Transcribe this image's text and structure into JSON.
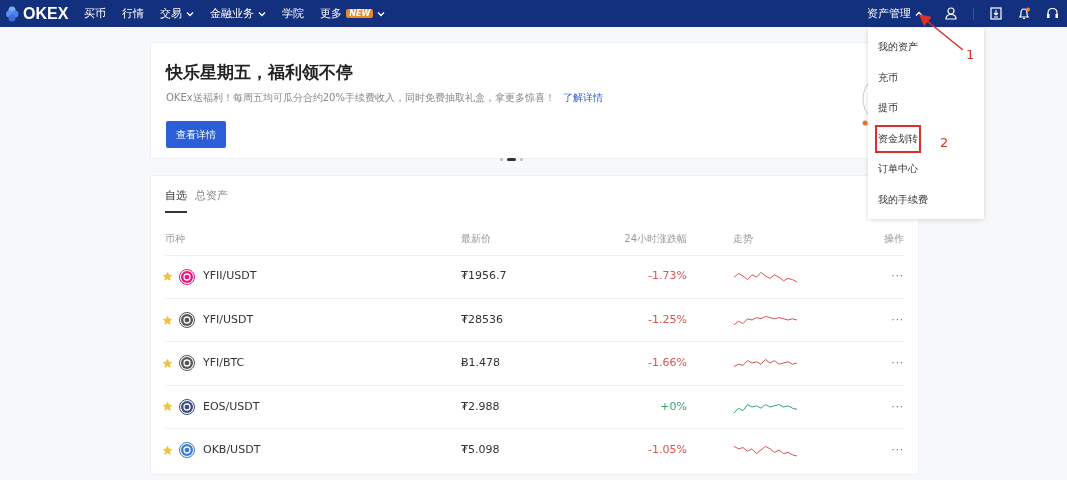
{
  "navbar": {
    "logo": "OKEX",
    "items": [
      {
        "label": "买币",
        "caret": false
      },
      {
        "label": "行情",
        "caret": false
      },
      {
        "label": "交易",
        "caret": true
      },
      {
        "label": "金融业务",
        "caret": true
      },
      {
        "label": "学院",
        "caret": false
      },
      {
        "label": "更多",
        "caret": true,
        "badge": "NEW"
      }
    ],
    "asset_menu": {
      "label": "资产管理",
      "expanded": true
    },
    "notification_dot": true
  },
  "banner": {
    "title": "快乐星期五，福利领不停",
    "text": "OKEx送福利！每周五均可瓜分合约20%手续费收入，同时免费抽取礼盒，拿更多惊喜！",
    "link": "了解详情",
    "button": "查看详情",
    "slides": [
      {
        "selected": false
      },
      {
        "selected": true
      },
      {
        "selected": false
      }
    ]
  },
  "market": {
    "tabs": [
      {
        "label": "自选",
        "selected": true
      },
      {
        "label": "总资产",
        "selected": false
      }
    ],
    "columns": [
      "币种",
      "最新价",
      "24小时涨跌幅",
      "走势",
      "操作"
    ],
    "rows": [
      {
        "pair": "YFII/USDT",
        "favorite": true,
        "color": "#d9534f",
        "price": "₮1956.7",
        "change": "-1.73%",
        "actions": "···"
      },
      {
        "pair": "YFI/USDT",
        "favorite": true,
        "color": "#d9534f",
        "price": "₮28536",
        "change": "-1.25%",
        "actions": "···"
      },
      {
        "pair": "YFI/BTC",
        "favorite": true,
        "color": "#d9534f",
        "price": "Ƀ1.478",
        "change": "-1.66%",
        "actions": "···"
      },
      {
        "pair": "EOS/USDT",
        "favorite": true,
        "color": "#3aa36b",
        "price": "₮2.988",
        "change": "+0%",
        "actions": "···"
      },
      {
        "pair": "OKB/USDT",
        "favorite": true,
        "color": "#d9534f",
        "price": "₮5.098",
        "change": "-1.05%",
        "actions": "···"
      }
    ]
  },
  "dropdown": {
    "items": [
      {
        "label": "我的资产",
        "highlighted": false
      },
      {
        "label": "充币",
        "highlighted": false
      },
      {
        "label": "提币",
        "highlighted": false
      },
      {
        "label": "资金划转",
        "highlighted": true
      },
      {
        "label": "订单中心",
        "highlighted": false
      },
      {
        "label": "我的手续费",
        "highlighted": false
      }
    ]
  },
  "annotations": [
    {
      "label": "1"
    },
    {
      "label": "2"
    }
  ]
}
